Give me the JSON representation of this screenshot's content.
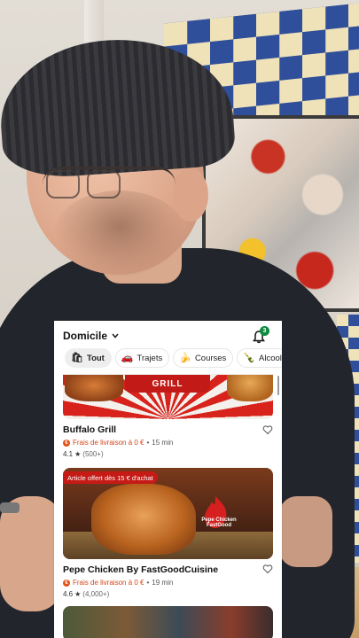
{
  "header": {
    "location": "Domicile",
    "notification_count": "3"
  },
  "categories": [
    {
      "label": "Tout",
      "icon": "bag-icon",
      "glyph": "🛍"
    },
    {
      "label": "Trajets",
      "icon": "car-icon",
      "glyph": "🚗"
    },
    {
      "label": "Courses",
      "icon": "banana-icon",
      "glyph": "🍌"
    },
    {
      "label": "Alcool",
      "icon": "bottle-icon",
      "glyph": "🍾"
    }
  ],
  "restaurants": [
    {
      "name": "Buffalo Grill",
      "banner_text": "GRILL",
      "delivery_fee": "Frais de livraison à 0 €",
      "separator": "•",
      "time": "15 min",
      "rating": "4.1",
      "reviews": "(500+)"
    },
    {
      "name": "Pepe Chicken By FastGoodCuisine",
      "promo": "Article offert dès 15 € d'achat",
      "logo_text": "Pepe Chicken FastGood",
      "delivery_fee": "Frais de livraison à 0 €",
      "separator": "•",
      "time": "19 min",
      "rating": "4.6",
      "reviews": "(4,000+)"
    }
  ],
  "colors": {
    "promo_red": "#c51a16",
    "fee_orange": "#d64418",
    "badge_green": "#0e8a3e"
  }
}
